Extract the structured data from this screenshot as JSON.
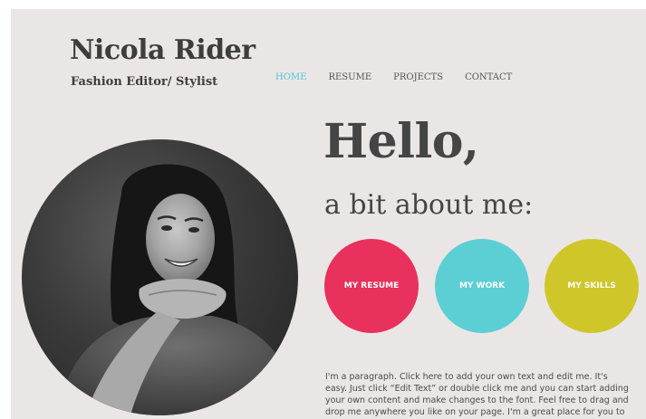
{
  "header": {
    "site_title": "Nicola Rider",
    "site_subtitle": "Fashion Editor/ Stylist"
  },
  "nav": {
    "items": [
      {
        "label": "HOME",
        "active": true
      },
      {
        "label": "RESUME",
        "active": false
      },
      {
        "label": "PROJECTS",
        "active": false
      },
      {
        "label": "CONTACT",
        "active": false
      }
    ]
  },
  "hero": {
    "heading": "Hello,",
    "subheading": "a bit about me:"
  },
  "buttons": {
    "resume": "MY RESUME",
    "work": "MY WORK",
    "skills": "MY SKILLS"
  },
  "about": {
    "paragraph": "I'm a paragraph. Click here to add your own text and edit me. It's easy. Just click “Edit Text” or double click me and you can start adding your own content and make changes to the font. Feel free to drag and drop me anywhere you like on your page. I'm a great place for you to write more. Tell a story and let your users get to know you."
  },
  "colors": {
    "background": "#ebe6e6",
    "nav_active": "#4fc6d3",
    "resume_button": "#e8315c",
    "work_button": "#5ccfd5",
    "skills_button": "#cfc72a",
    "heading_text": "#454545"
  },
  "photo": {
    "description_icon": "portrait-photo"
  }
}
